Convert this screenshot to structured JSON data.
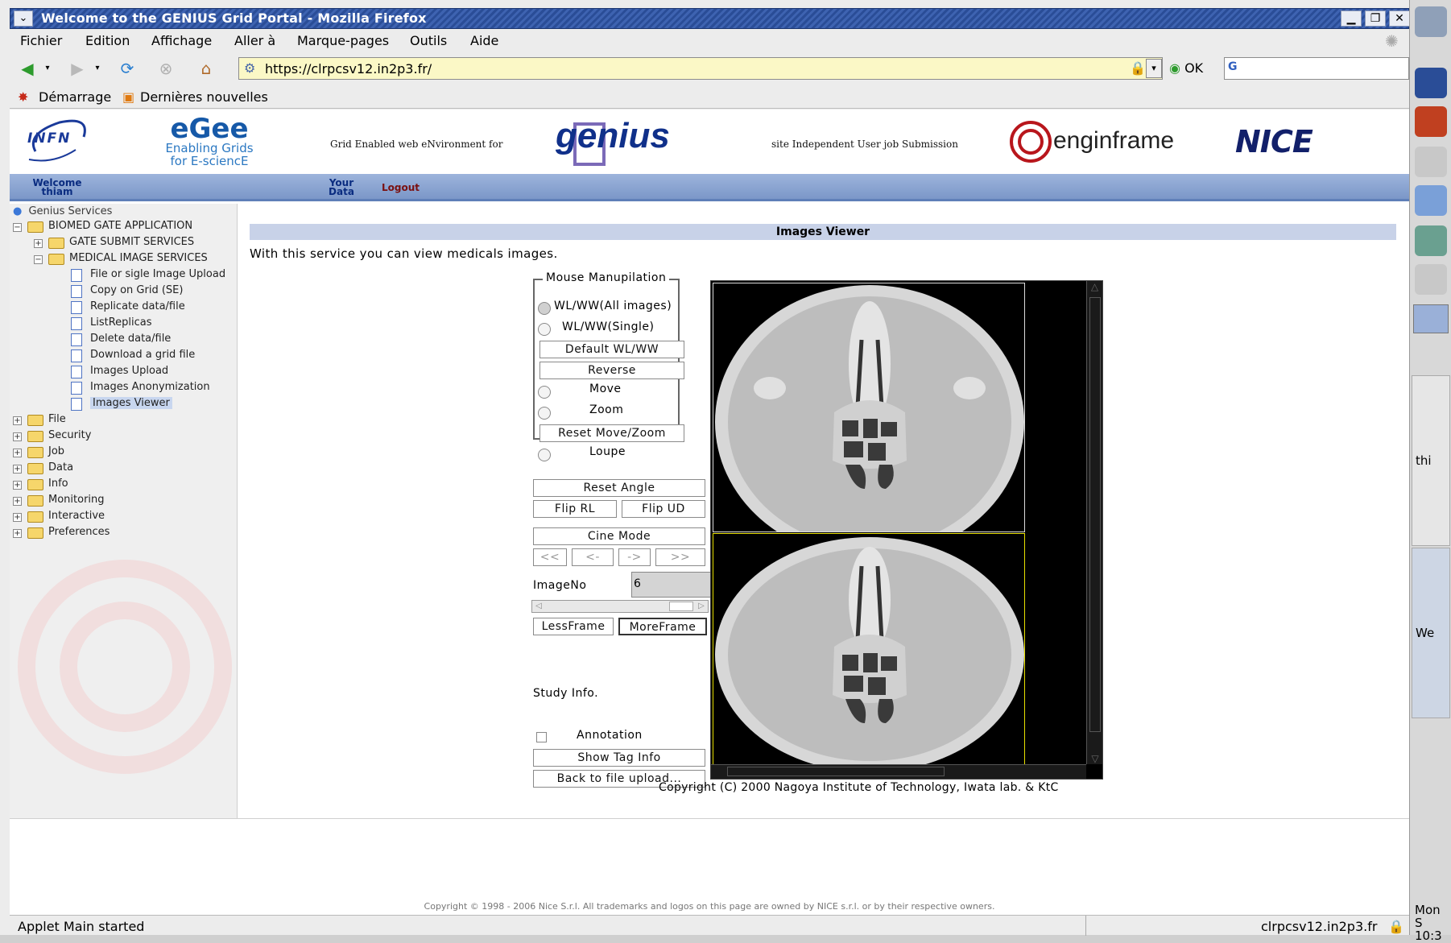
{
  "window": {
    "title": "Welcome to the GENIUS Grid Portal - Mozilla Firefox"
  },
  "menubar": [
    "Fichier",
    "Edition",
    "Affichage",
    "Aller à",
    "Marque-pages",
    "Outils",
    "Aide"
  ],
  "navbar": {
    "url": "https://clrpcsv12.in2p3.fr/",
    "go_label": "OK"
  },
  "bookmarks": [
    "Démarrage",
    "Dernières nouvelles"
  ],
  "header": {
    "infn": "INFN",
    "egee_line1": "eGee",
    "egee_line2": "Enabling Grids",
    "egee_line3": "for E-sciencE",
    "genius_tagline": "Grid Enabled web eNvironment for",
    "genius_logo": "genius",
    "site_tagline": "site Independent User job Submission",
    "enginframe": "enginframe",
    "nice": "NICE"
  },
  "bluebar": {
    "welcome_line1": "Welcome",
    "welcome_line2": "thiam",
    "your_line1": "Your",
    "your_line2": "Data",
    "logout": "Logout"
  },
  "sidebar": {
    "root": "Genius Services",
    "app": "BIOMED GATE APPLICATION",
    "gate": "GATE SUBMIT SERVICES",
    "medical": "MEDICAL IMAGE SERVICES",
    "medical_items": [
      "File or sigle Image Upload",
      "Copy on Grid (SE)",
      "Replicate data/file",
      "ListReplicas",
      "Delete data/file",
      "Download a grid file",
      "Images Upload",
      "Images Anonymization",
      "Images Viewer"
    ],
    "folders": [
      "File",
      "Security",
      "Job",
      "Data",
      "Info",
      "Monitoring",
      "Interactive",
      "Preferences"
    ]
  },
  "content": {
    "title": "Images Viewer",
    "intro": "With this service you can view medicals images.",
    "mouse_group": "Mouse Manupilation",
    "wl_all": "WL/WW(All images)",
    "wl_single": "WL/WW(Single)",
    "default_wl": "Default WL/WW",
    "reverse": "Reverse",
    "move": "Move",
    "zoom": "Zoom",
    "reset_move": "Reset Move/Zoom",
    "loupe": "Loupe",
    "reset_angle": "Reset Angle",
    "flip_rl": "Flip RL",
    "flip_ud": "Flip UD",
    "cine_mode": "Cine Mode",
    "cine_buttons": [
      "<<",
      "<-",
      "->",
      ">>"
    ],
    "image_no_label": "ImageNo",
    "image_no_value": "6",
    "less_frame": "LessFrame",
    "more_frame": "MoreFrame",
    "study_info": "Study Info.",
    "annotation": "Annotation",
    "show_tag": "Show Tag Info",
    "back_upload": "Back to file upload...",
    "applet_copyright": "Copyright (C) 2000 Nagoya Institute of Technology, Iwata lab. & KtC"
  },
  "footer": {
    "copyright": "Copyright © 1998 - 2006 Nice S.r.l. All trademarks and logos on this page are owned by NICE s.r.l. or by their respective owners."
  },
  "statusbar": {
    "left": "Applet Main started",
    "host": "clrpcsv12.in2p3.fr"
  },
  "rightpanel": {
    "task1": "thi",
    "task2": "We",
    "clock_line1": "Mon S",
    "clock_line2": "10:3"
  },
  "colors": {
    "titlebar": "#2a4d97",
    "urlbar_bg": "#fbf8c6",
    "bluebar": "#8aa4d2",
    "sidebar_selected": "#c8d6ef",
    "image_border": "#e8e000"
  }
}
